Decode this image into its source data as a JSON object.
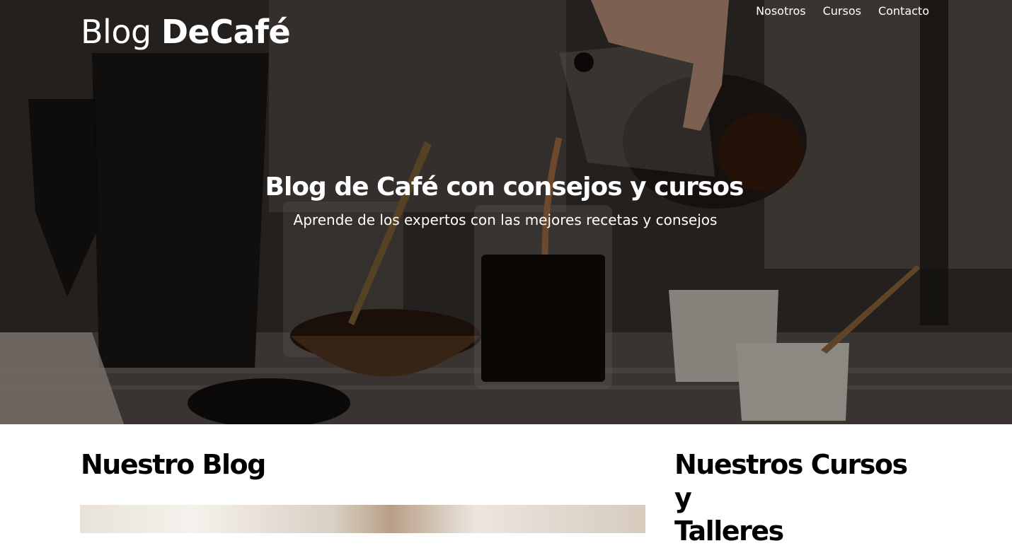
{
  "header": {
    "logo_light": "Blog ",
    "logo_bold": "DeCafé",
    "nav": [
      {
        "label": "Nosotros"
      },
      {
        "label": "Cursos"
      },
      {
        "label": "Contacto"
      }
    ]
  },
  "hero": {
    "title": "Blog de Café con consejos y cursos",
    "subtitle": "Aprende de los expertos con las mejores recetas y consejos"
  },
  "main": {
    "blog_title": "Nuestro Blog",
    "courses_title_line1": "Nuestros Cursos y",
    "courses_title_line2": "Talleres"
  },
  "colors": {
    "text_on_hero": "#ffffff",
    "heading": "#000000",
    "background": "#ffffff"
  }
}
